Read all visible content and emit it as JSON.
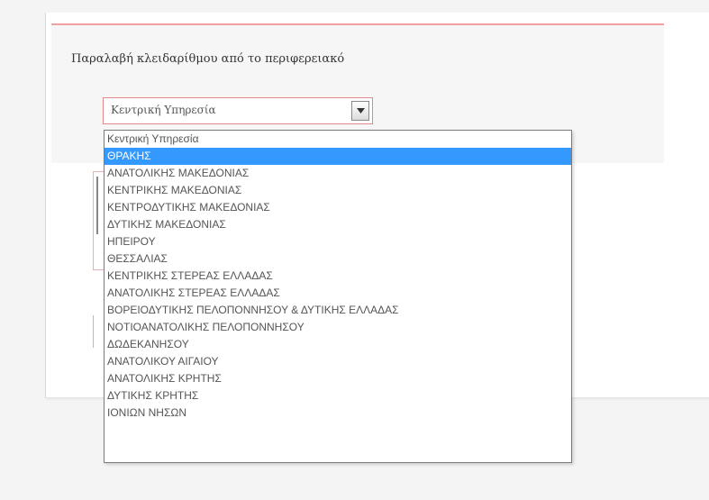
{
  "form": {
    "label": "Παραλαβή κλειδαρίθμου από το περιφερειακό",
    "select": {
      "current_value": "Κεντρική Υπηρεσία",
      "highlighted_index": 1,
      "options": [
        "Κεντρική Υπηρεσία",
        "ΘΡΑΚΗΣ",
        "ΑΝΑΤΟΛΙΚΗΣ ΜΑΚΕΔΟΝΙΑΣ",
        "ΚΕΝΤΡΙΚΗΣ ΜΑΚΕΔΟΝΙΑΣ",
        "ΚΕΝΤΡΟΔΥΤΙΚΗΣ ΜΑΚΕΔΟΝΙΑΣ",
        "ΔΥΤΙΚΗΣ ΜΑΚΕΔΟΝΙΑΣ",
        "ΗΠΕΙΡΟΥ",
        "ΘΕΣΣΑΛΙΑΣ",
        "ΚΕΝΤΡΙΚΗΣ ΣΤΕΡΕΑΣ ΕΛΛΑΔΑΣ",
        "ΑΝΑΤΟΛΙΚΗΣ ΣΤΕΡΕΑΣ ΕΛΛΑΔΑΣ",
        "ΒΟΡΕΙΟΔΥΤΙΚΗΣ ΠΕΛΟΠΟΝΝΗΣΟΥ & ΔΥΤΙΚΗΣ ΕΛΛΑΔΑΣ",
        "ΝΟΤΙΟΑΝΑΤΟΛΙΚΗΣ ΠΕΛΟΠΟΝΝΗΣΟΥ",
        "ΔΩΔΕΚΑΝΗΣΟΥ",
        "ΑΝΑΤΟΛΙΚΟΥ ΑΙΓΑΙΟΥ",
        "ΑΝΑΤΟΛΙΚΗΣ ΚΡΗΤΗΣ",
        "ΔΥΤΙΚΗΣ ΚΡΗΤΗΣ",
        "ΙΟΝΙΩΝ ΝΗΣΩΝ"
      ]
    }
  },
  "colors": {
    "highlight": "#3399ff",
    "error_border": "#e08a8a",
    "section_top_border": "#f0a0a0"
  },
  "icons": {
    "select_arrow": "chevron-down-icon"
  }
}
